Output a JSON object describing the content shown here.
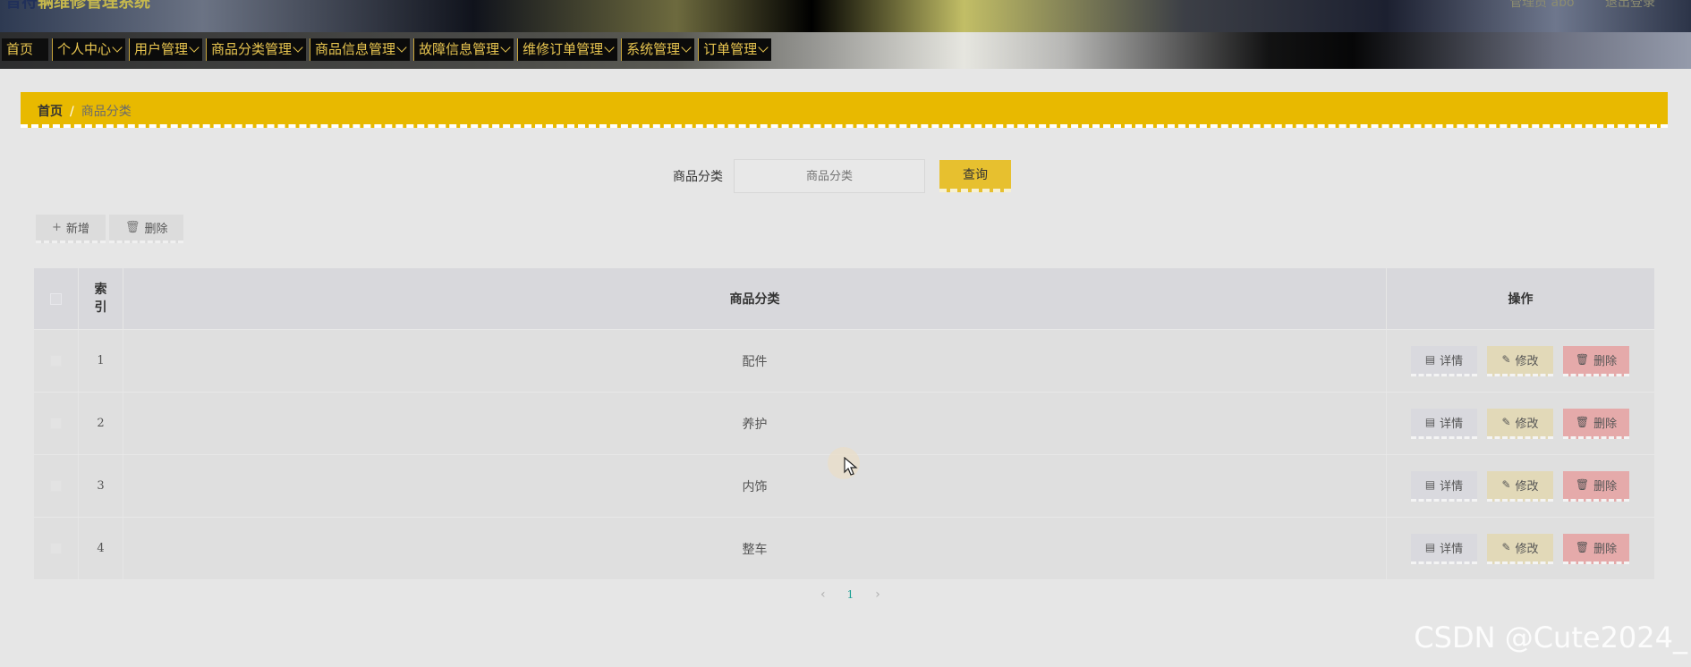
{
  "header": {
    "logo_text": "音符",
    "system_title": "辆维修管理系统",
    "user_label": "管理员 abo",
    "logout_label": "退出登录"
  },
  "nav": [
    {
      "label": "首页"
    },
    {
      "label": "个人中心"
    },
    {
      "label": "用户管理"
    },
    {
      "label": "商品分类管理"
    },
    {
      "label": "商品信息管理"
    },
    {
      "label": "故障信息管理"
    },
    {
      "label": "维修订单管理"
    },
    {
      "label": "系统管理"
    },
    {
      "label": "订单管理"
    }
  ],
  "breadcrumb": {
    "home": "首页",
    "separator": "/",
    "current": "商品分类"
  },
  "search": {
    "label": "商品分类",
    "placeholder": "商品分类",
    "button_label": "查询"
  },
  "actions": {
    "add_label": "新增",
    "delete_label": "删除"
  },
  "table": {
    "headers": {
      "index": "索引",
      "name": "商品分类",
      "ops": "操作"
    },
    "rows": [
      {
        "index": "1",
        "name": "配件"
      },
      {
        "index": "2",
        "name": "养护"
      },
      {
        "index": "3",
        "name": "内饰"
      },
      {
        "index": "4",
        "name": "整车"
      }
    ],
    "row_actions": {
      "detail": "详情",
      "edit": "修改",
      "delete": "删除"
    }
  },
  "pagination": {
    "prev": "‹",
    "current_page": "1",
    "next": "›"
  },
  "watermark": "CSDN @Cute2024_",
  "colors": {
    "accent": "#e8b900",
    "search_button": "#e7c02f",
    "nav_text": "#e9c650",
    "delete_button": "#e5aaaa",
    "edit_button": "#e2d9b8",
    "page_active": "#1aa094"
  }
}
